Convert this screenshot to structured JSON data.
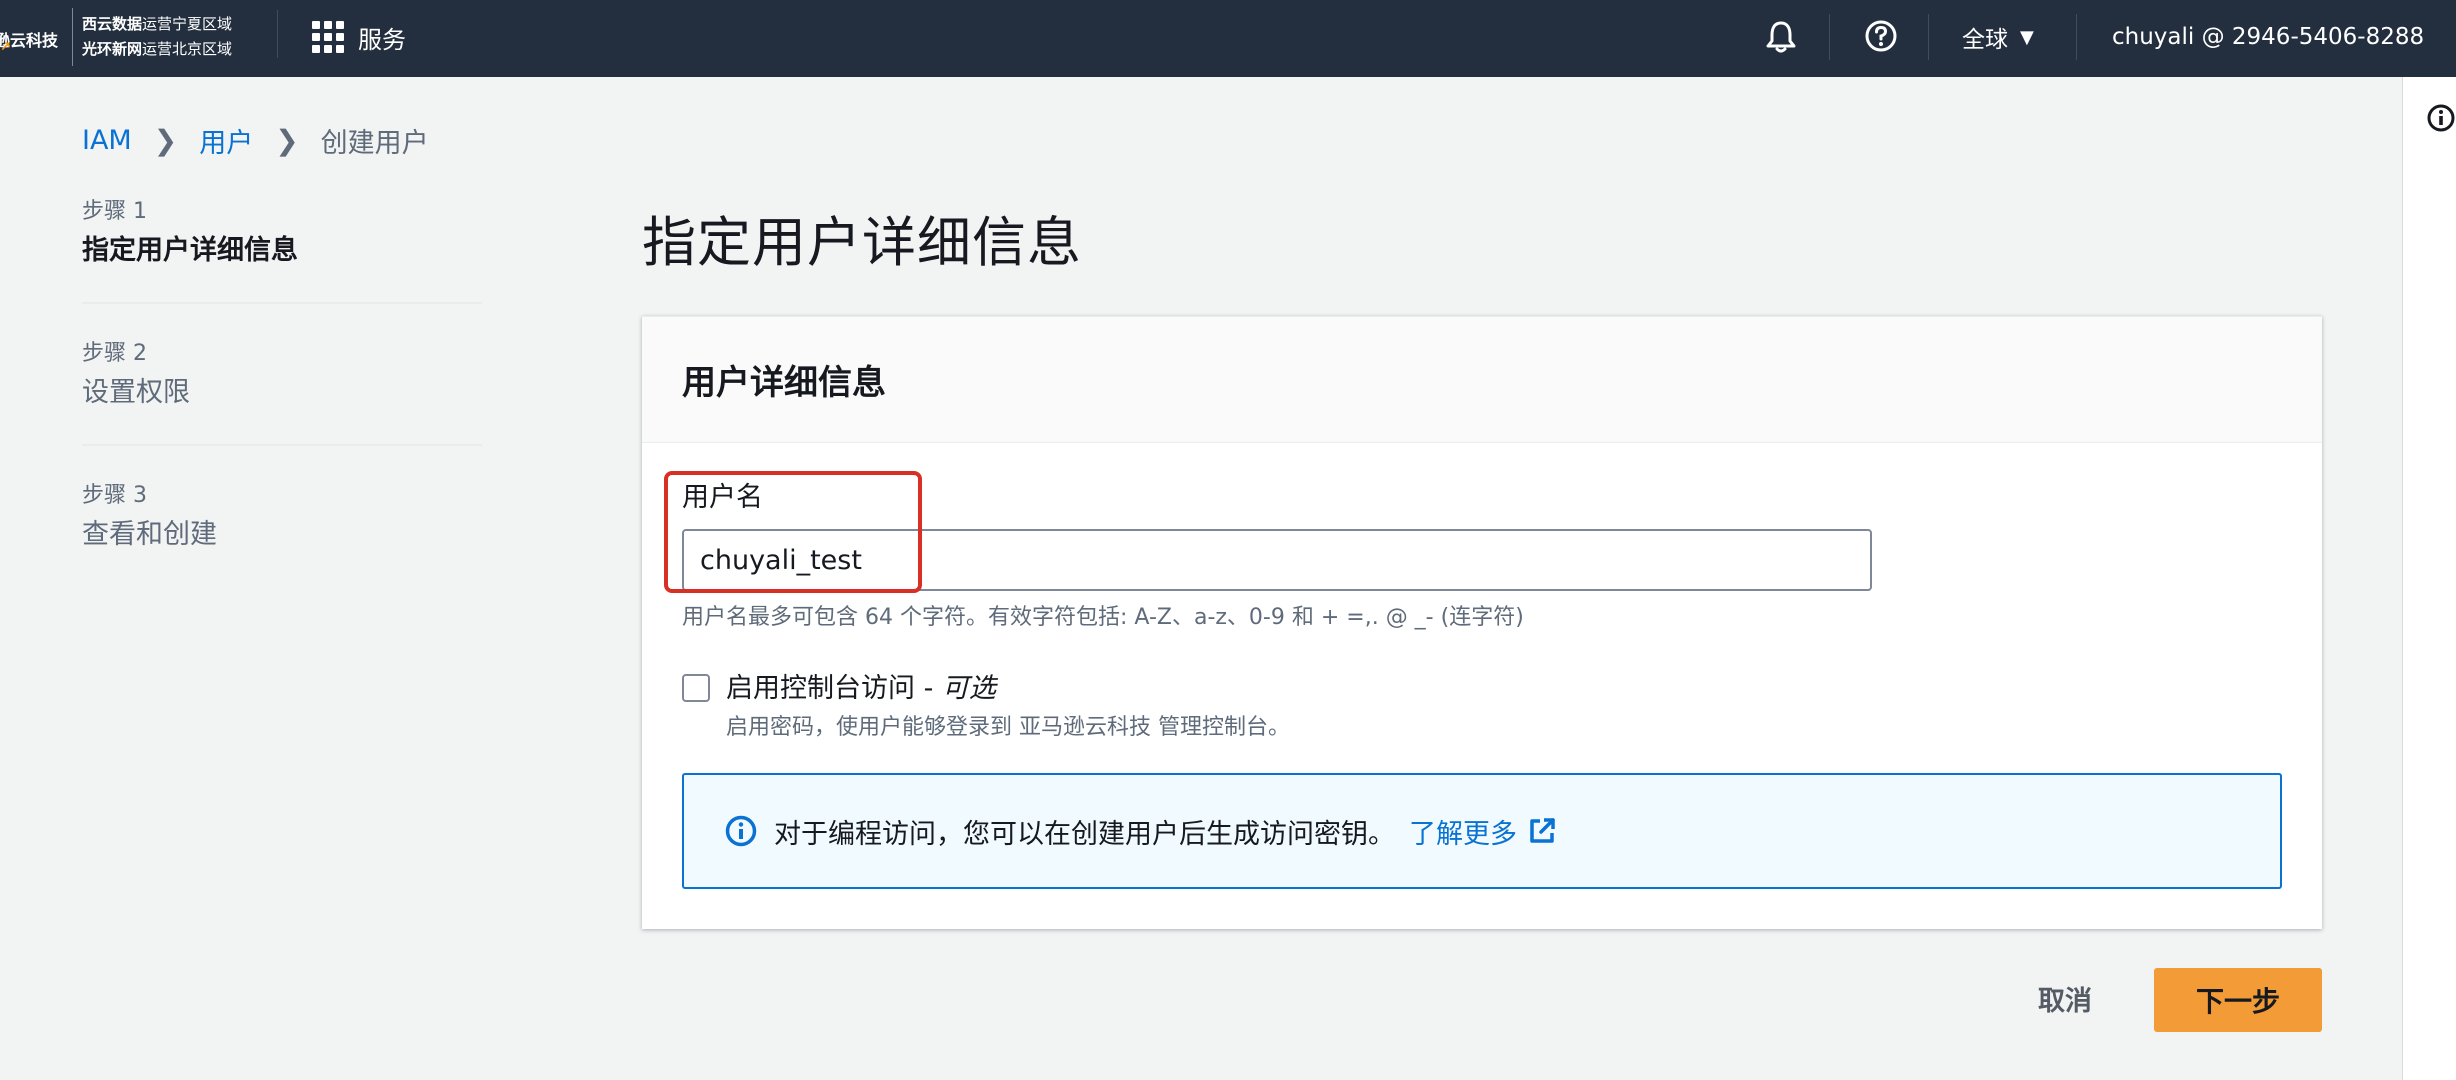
{
  "topnav": {
    "brand": "逊云科技",
    "brand_smile": "↗",
    "region_line1_bold": "西云数据",
    "region_line1": "运营宁夏区域",
    "region_line2_bold": "光环新网",
    "region_line2": "运营北京区域",
    "services_label": "服务",
    "region_selector": "全球",
    "account": "chuyali @ 2946-5406-8288"
  },
  "breadcrumb": {
    "items": [
      "IAM",
      "用户",
      "创建用户"
    ]
  },
  "steps": [
    {
      "num": "步骤 1",
      "title": "指定用户详细信息",
      "active": true
    },
    {
      "num": "步骤 2",
      "title": "设置权限",
      "active": false
    },
    {
      "num": "步骤 3",
      "title": "查看和创建",
      "active": false
    }
  ],
  "page_title": "指定用户详细信息",
  "panel": {
    "title": "用户详细信息",
    "username_label": "用户名",
    "username_value": "chuyali_test",
    "username_constraint": "用户名最多可包含 64 个字符。有效字符包括: A-Z、a-z、0-9 和 + =,. @ _- (连字符)",
    "console_access_label": "启用控制台访问 - ",
    "console_access_optional": "可选",
    "console_access_desc": "启用密码，使用户能够登录到 亚马逊云科技 管理控制台。",
    "alert_text": "对于编程访问，您可以在创建用户后生成访问密钥。",
    "alert_link": "了解更多"
  },
  "footer": {
    "cancel_label": "取消",
    "next_label": "下一步"
  },
  "colors": {
    "nav_bg": "#232f3e",
    "link": "#0972d3",
    "primary_button": "#f39b36",
    "highlight": "#d93025",
    "alert_bg": "#f1faff"
  },
  "icons": [
    "grid-icon",
    "bell-icon",
    "help-icon",
    "caret-down-icon",
    "info-icon",
    "chevron-right-icon",
    "external-link-icon"
  ]
}
